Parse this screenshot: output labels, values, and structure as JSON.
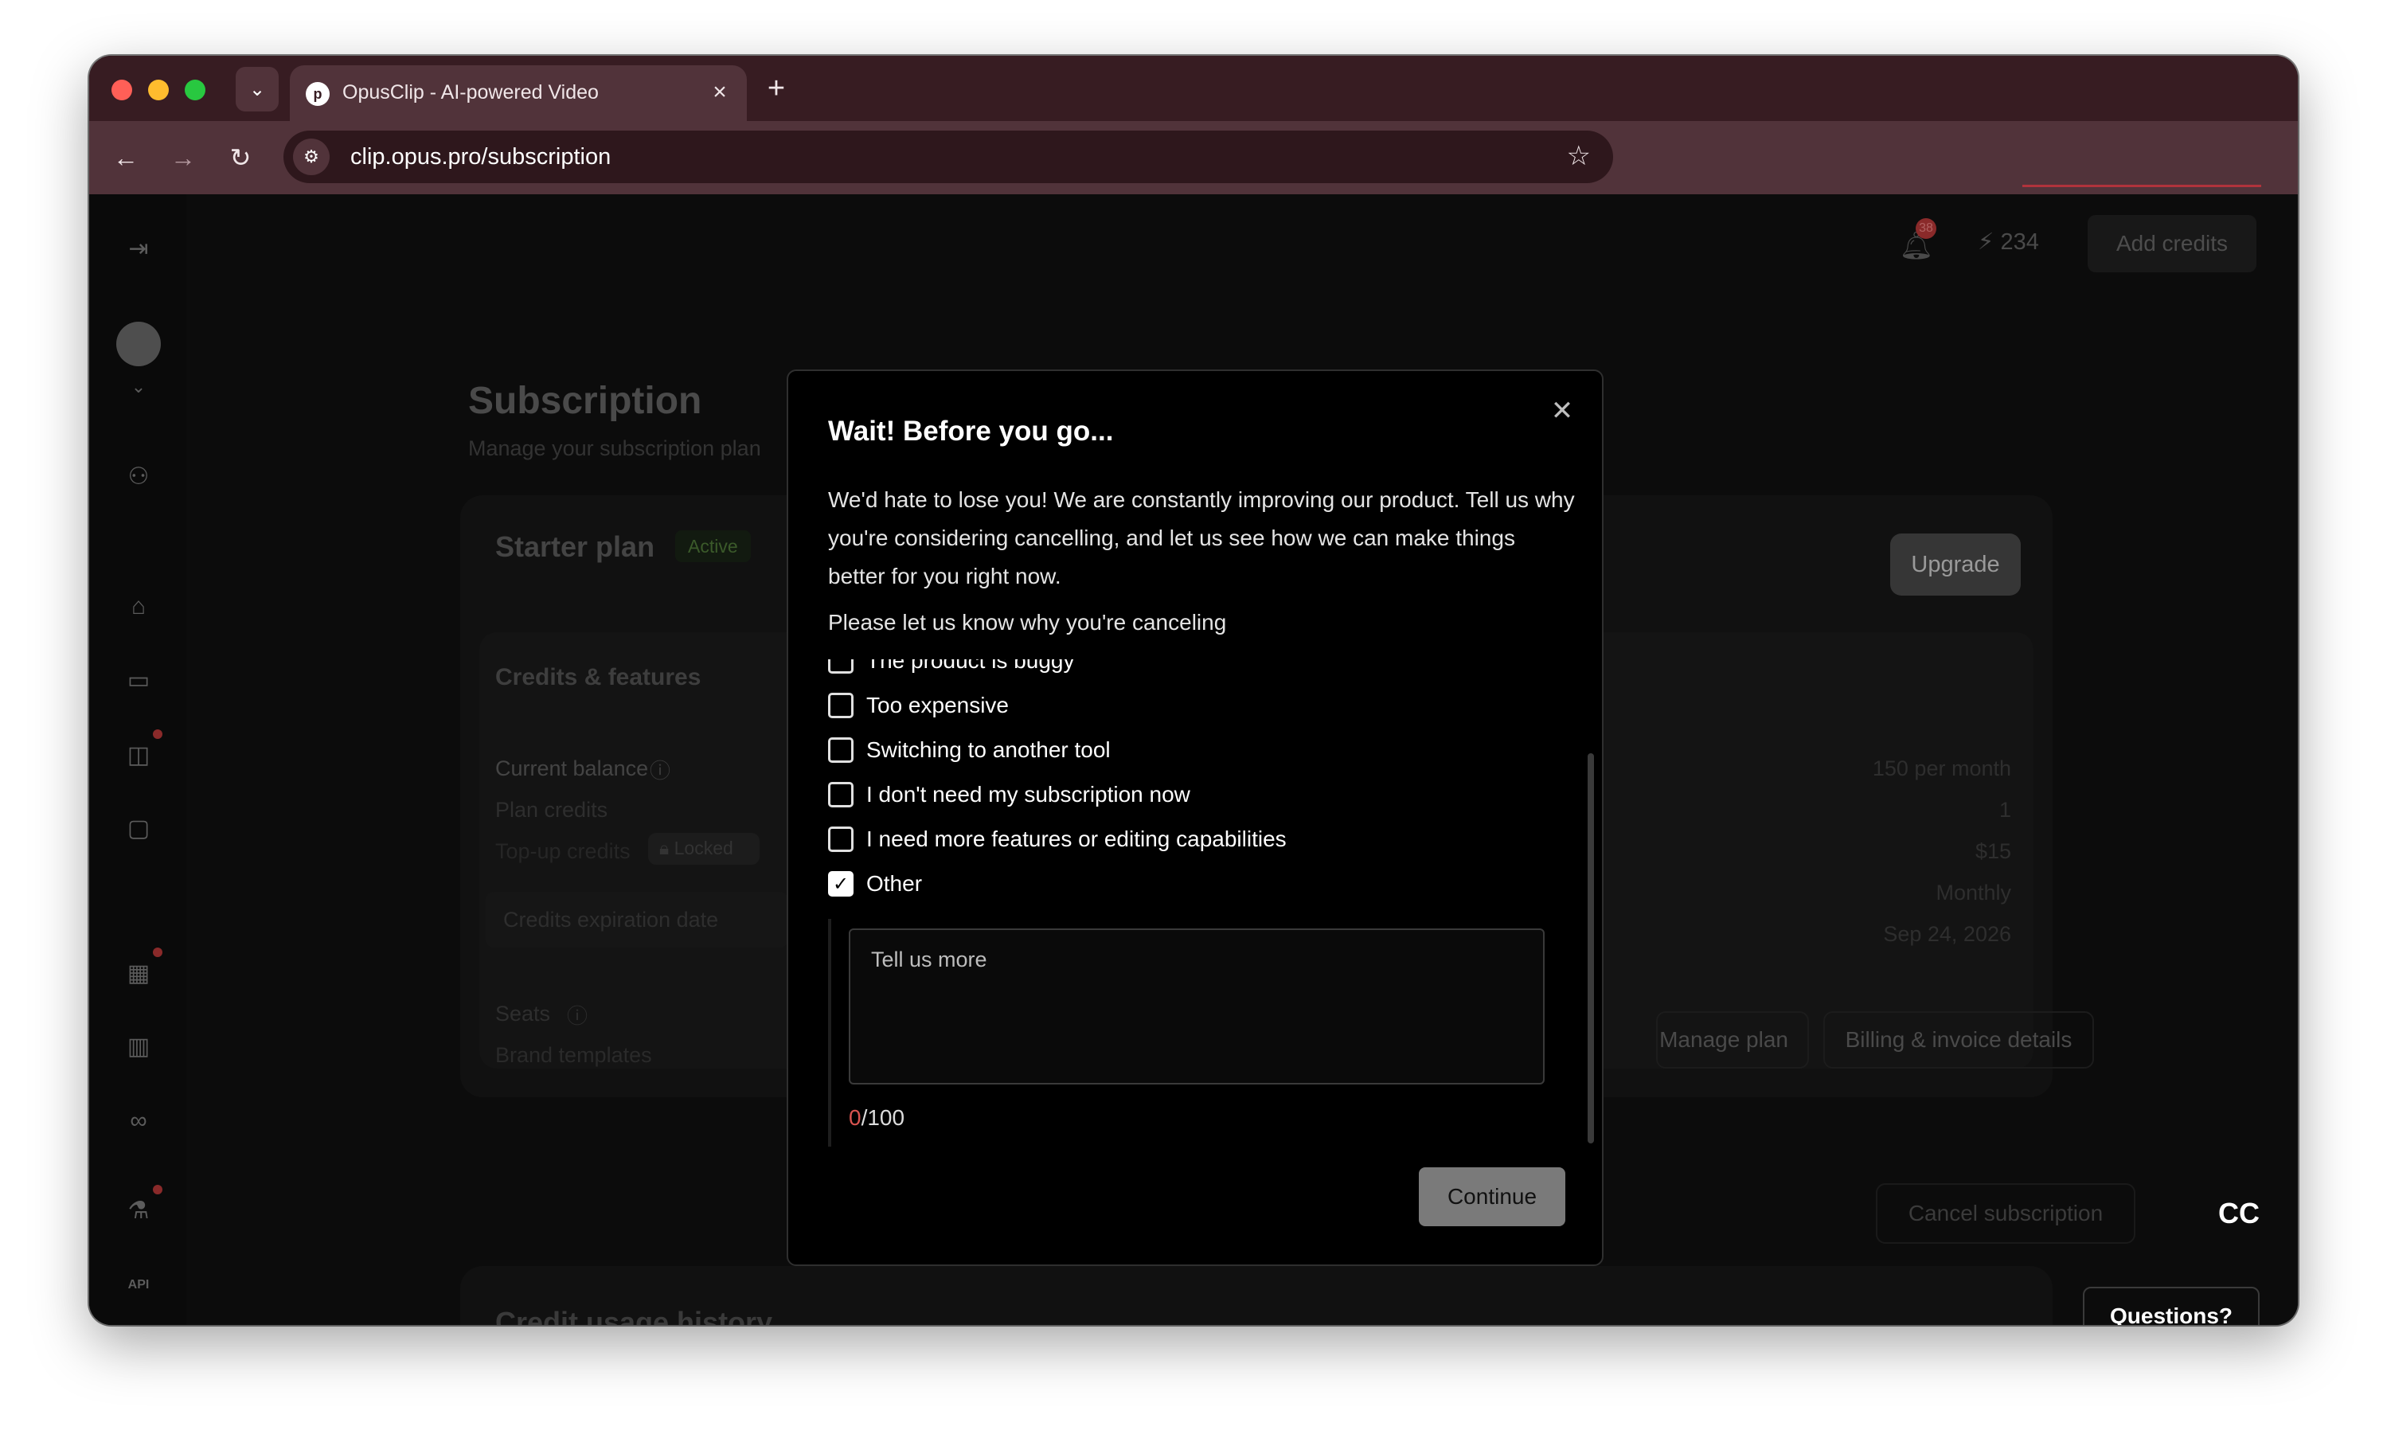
{
  "browser": {
    "tab_title": "OpusClip - AI-powered Video",
    "tab_favicon_letter": "p",
    "url": "clip.opus.pro/subscription"
  },
  "header": {
    "notification_count": "38",
    "credits": "234",
    "add_credits_label": "Add credits"
  },
  "page": {
    "title": "Subscription",
    "subtitle": "Manage your subscription plan"
  },
  "plan": {
    "name": "Starter plan",
    "status": "Active",
    "upgrade_label": "Upgrade"
  },
  "credits": {
    "heading": "Credits & features",
    "current_balance_label": "Current balance",
    "plan_credits_label": "Plan credits",
    "topup_label": "Top-up credits",
    "locked_label": "Locked",
    "expiration_label": "Credits expiration date",
    "seats_label": "Seats",
    "brand_templates_label": "Brand templates",
    "values": [
      "150 per month",
      "1",
      "$15",
      "Monthly",
      "Sep 24, 2026"
    ]
  },
  "actions": {
    "manage_plan": "Manage plan",
    "billing": "Billing & invoice details",
    "cancel": "Cancel subscription"
  },
  "history": {
    "title": "Credit usage history"
  },
  "modal": {
    "title": "Wait! Before you go...",
    "description": "We'd hate to lose you! We are constantly improving our product. Tell us why you're considering cancelling, and let us see how we can make things better for you right now.",
    "prompt": "Please let us know why you're canceling",
    "options": [
      {
        "label": "The product is buggy",
        "checked": false
      },
      {
        "label": "Too expensive",
        "checked": false
      },
      {
        "label": "Switching to another tool",
        "checked": false
      },
      {
        "label": "I don't need my subscription now",
        "checked": false
      },
      {
        "label": "I need more features or editing capabilities",
        "checked": false
      },
      {
        "label": "Other",
        "checked": true
      }
    ],
    "textarea_placeholder": "Tell us more",
    "char_count": "0",
    "char_limit": "/100",
    "continue_label": "Continue"
  },
  "support": {
    "questions_label": "Questions?",
    "cc_label": "CC"
  },
  "colors": {
    "chrome": "#371c22",
    "toolbar": "#51333a",
    "accent_red": "#d9534f"
  }
}
